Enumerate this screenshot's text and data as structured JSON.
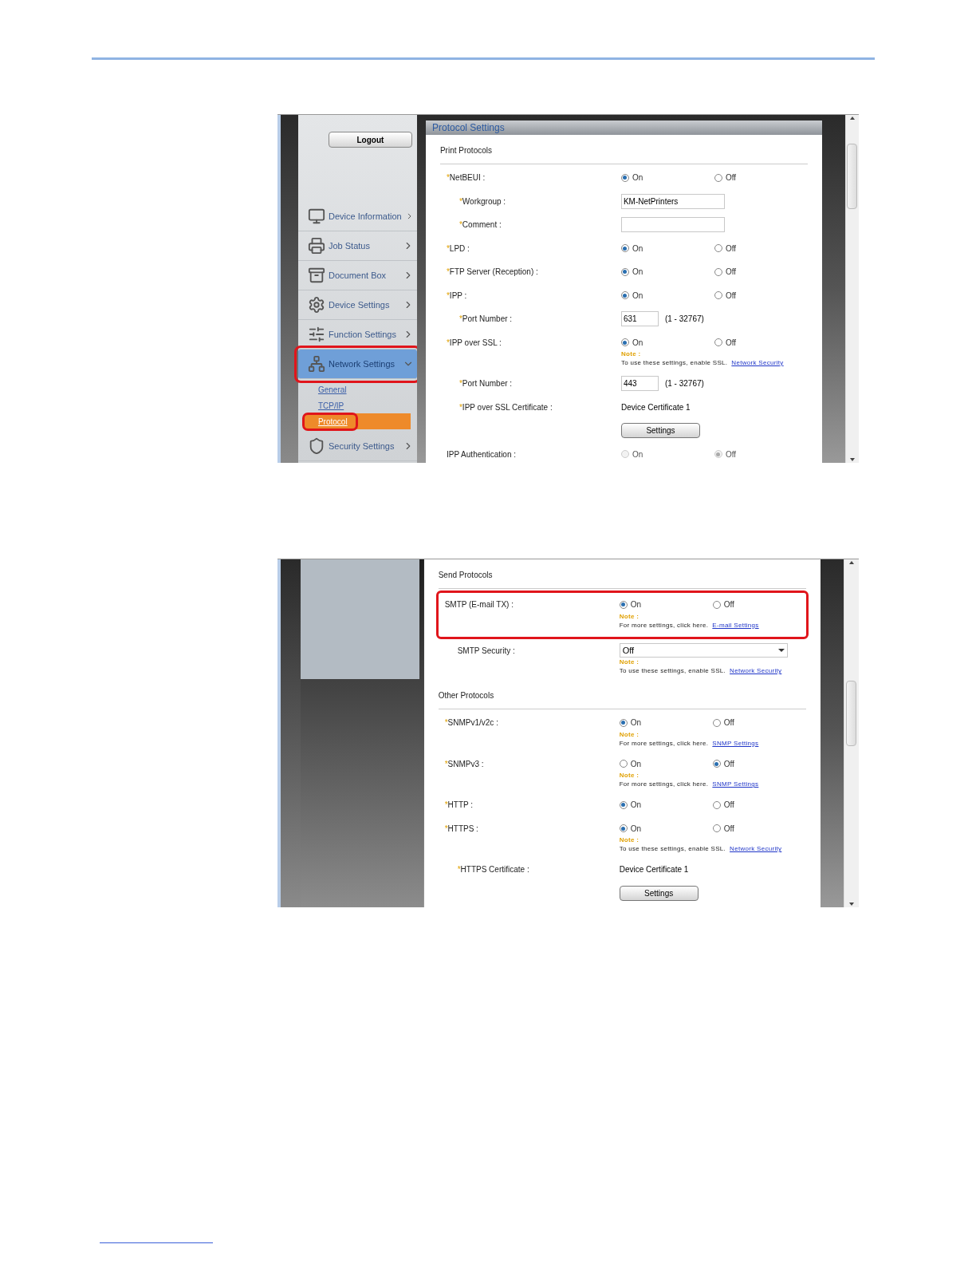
{
  "screens": [
    {
      "sidebar": {
        "logout": "Logout",
        "items": [
          {
            "label": "Device Information",
            "expanded": false,
            "highlighted": false
          },
          {
            "label": "Job Status",
            "expanded": false,
            "highlighted": false
          },
          {
            "label": "Document Box",
            "expanded": false,
            "highlighted": false
          },
          {
            "label": "Device Settings",
            "expanded": false,
            "highlighted": false
          },
          {
            "label": "Function Settings",
            "expanded": false,
            "highlighted": false
          },
          {
            "label": "Network Settings",
            "expanded": true,
            "highlighted": true,
            "children": [
              {
                "label": "General",
                "selected": false,
                "highlighted": false
              },
              {
                "label": "TCP/IP",
                "selected": false,
                "highlighted": false
              },
              {
                "label": "Protocol",
                "selected": true,
                "highlighted": true
              }
            ]
          },
          {
            "label": "Security Settings",
            "expanded": false,
            "highlighted": false
          }
        ]
      },
      "panel_title": "Protocol Settings",
      "sections": [
        {
          "title": "Print Protocols",
          "rows": [
            {
              "kind": "radio",
              "mark": "*",
              "label": "NetBEUI :",
              "disabled": false,
              "options": [
                {
                  "label": "On",
                  "selected": true
                },
                {
                  "label": "Off",
                  "selected": false
                }
              ],
              "children": [
                {
                  "kind": "input",
                  "mark": "*",
                  "label": "Workgroup :",
                  "value": "KM-NetPrinters"
                },
                {
                  "kind": "input",
                  "mark": "*",
                  "label": "Comment :"
                }
              ]
            },
            {
              "kind": "radio",
              "mark": "*",
              "label": "LPD :",
              "disabled": false,
              "options": [
                {
                  "label": "On",
                  "selected": true
                },
                {
                  "label": "Off",
                  "selected": false
                }
              ]
            },
            {
              "kind": "radio",
              "mark": "*",
              "label": "FTP Server (Reception) :",
              "disabled": false,
              "options": [
                {
                  "label": "On",
                  "selected": true
                },
                {
                  "label": "Off",
                  "selected": false
                }
              ]
            },
            {
              "kind": "radio",
              "mark": "*",
              "label": "IPP :",
              "disabled": false,
              "options": [
                {
                  "label": "On",
                  "selected": true
                },
                {
                  "label": "Off",
                  "selected": false
                }
              ],
              "children": [
                {
                  "kind": "port",
                  "mark": "*",
                  "label": "Port Number :",
                  "value": "631",
                  "range": "(1 - 32767)"
                }
              ]
            },
            {
              "kind": "radio",
              "mark": "*",
              "label": "IPP over SSL :",
              "disabled": false,
              "options": [
                {
                  "label": "On",
                  "selected": true
                },
                {
                  "label": "Off",
                  "selected": false
                }
              ],
              "note": {
                "title": "Note :",
                "text": "To use these settings, enable SSL.",
                "link": "Network Security"
              },
              "children": [
                {
                  "kind": "port",
                  "mark": "*",
                  "label": "Port Number :",
                  "value": "443",
                  "range": "(1 - 32767)"
                },
                {
                  "kind": "value",
                  "mark": "*",
                  "label": "IPP over SSL Certificate :",
                  "value": "Device Certificate 1"
                },
                {
                  "kind": "button",
                  "value": "Settings"
                }
              ]
            },
            {
              "kind": "radio",
              "label": "IPP Authentication :",
              "disabled": true,
              "options": [
                {
                  "label": "On",
                  "selected": false
                },
                {
                  "label": "Off",
                  "selected": true
                }
              ]
            }
          ]
        }
      ]
    },
    {
      "sections": [
        {
          "title": "Send Protocols",
          "rows": [
            {
              "kind": "radio",
              "label": "SMTP (E-mail TX) :",
              "disabled": false,
              "highlighted": true,
              "options": [
                {
                  "label": "On",
                  "selected": true
                },
                {
                  "label": "Off",
                  "selected": false
                }
              ],
              "note": {
                "title": "Note :",
                "text": "For more settings, click here.",
                "link": "E-mail Settings"
              },
              "children": [
                {
                  "kind": "select",
                  "label": "SMTP Security :",
                  "value": "Off",
                  "note": {
                    "title": "Note :",
                    "text": "To use these settings, enable SSL.",
                    "link": "Network Security"
                  }
                }
              ]
            }
          ]
        },
        {
          "title": "Other Protocols",
          "rows": [
            {
              "kind": "radio",
              "mark": "*",
              "label": "SNMPv1/v2c :",
              "disabled": false,
              "options": [
                {
                  "label": "On",
                  "selected": true
                },
                {
                  "label": "Off",
                  "selected": false
                }
              ],
              "note": {
                "title": "Note :",
                "text": "For more settings, click here.",
                "link": "SNMP Settings"
              }
            },
            {
              "kind": "radio",
              "mark": "*",
              "label": "SNMPv3 :",
              "disabled": false,
              "options": [
                {
                  "label": "On",
                  "selected": false
                },
                {
                  "label": "Off",
                  "selected": true
                }
              ],
              "note": {
                "title": "Note :",
                "text": "For more settings, click here.",
                "link": "SNMP Settings"
              }
            },
            {
              "kind": "radio",
              "mark": "*",
              "label": "HTTP :",
              "disabled": false,
              "options": [
                {
                  "label": "On",
                  "selected": true
                },
                {
                  "label": "Off",
                  "selected": false
                }
              ]
            },
            {
              "kind": "radio",
              "mark": "*",
              "label": "HTTPS :",
              "disabled": false,
              "options": [
                {
                  "label": "On",
                  "selected": true
                },
                {
                  "label": "Off",
                  "selected": false
                }
              ],
              "note": {
                "title": "Note :",
                "text": "To use these settings, enable SSL.",
                "link": "Network Security"
              },
              "children": [
                {
                  "kind": "value",
                  "mark": "*",
                  "label": "HTTPS Certificate :",
                  "value": "Device Certificate 1"
                },
                {
                  "kind": "button",
                  "value": "Settings"
                }
              ]
            }
          ]
        }
      ]
    }
  ]
}
